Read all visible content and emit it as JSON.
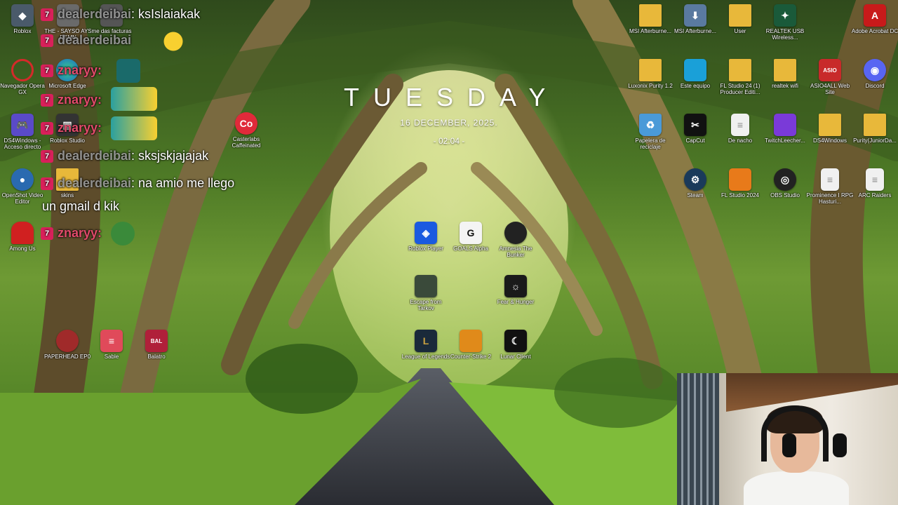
{
  "clock": {
    "day": "TUESDAY",
    "date": "16 DECEMBER, 2025.",
    "time": "- 02:04 -"
  },
  "desktop_icons": [
    {
      "label": "Roblox",
      "icon": "roblox-studio-icon",
      "color": "#4a5a6a"
    },
    {
      "label": "Navegador Opera GX",
      "icon": "opera-gx-icon",
      "color": "#d42a2a"
    },
    {
      "label": "DS4Windows - Acceso directo",
      "icon": "gamepad-icon",
      "color": "#5a4ac8"
    },
    {
      "label": "OpenShot Video Editor",
      "icon": "openshot-icon",
      "color": "#2a6ab0"
    },
    {
      "label": "Among Us",
      "icon": "among-us-icon",
      "color": "#d02020"
    },
    {
      "label": "THE - SAYSO AYS DEMN",
      "icon": "file-icon",
      "color": "#6a6a6a"
    },
    {
      "label": "me das facturas",
      "icon": "file-icon",
      "color": "#555"
    },
    {
      "label": "Microsoft Edge",
      "icon": "edge-icon",
      "color": "#1a8ac8"
    },
    {
      "label": "Roblox Studio",
      "icon": "roblox-icon",
      "color": "#333"
    },
    {
      "label": "skins",
      "icon": "folder-icon",
      "color": "#e8b83a"
    },
    {
      "label": "Casterlabs Caffeinated",
      "icon": "casterlabs-icon",
      "color": "#e02a3a"
    },
    {
      "label": "PAPERHEAD EP0",
      "icon": "paperhead-icon",
      "color": "#a02a2a"
    },
    {
      "label": "Sable",
      "icon": "sable-icon",
      "color": "#e04a5a"
    },
    {
      "label": "Balatro",
      "icon": "balatro-icon",
      "color": "#b0203a"
    },
    {
      "label": "Roblox Player",
      "icon": "roblox-player-icon",
      "color": "#1a5ae0"
    },
    {
      "label": "GOALS Alpha",
      "icon": "goals-icon",
      "color": "#f4f4f4"
    },
    {
      "label": "Amnesia The Bunker",
      "icon": "amnesia-icon",
      "color": "#222"
    },
    {
      "label": "Escape from Tarkov",
      "icon": "tarkov-icon",
      "color": "#3a4a3a"
    },
    {
      "label": "Fear & Hunger",
      "icon": "fear-hunger-icon",
      "color": "#1a1a1a"
    },
    {
      "label": "League of Legends",
      "icon": "league-icon",
      "color": "#1a2a3a"
    },
    {
      "label": "Counter-Strike 2",
      "icon": "cs2-icon",
      "color": "#e08a1a"
    },
    {
      "label": "Lunar Client",
      "icon": "lunar-icon",
      "color": "#111"
    },
    {
      "label": "MSI Afterburne...",
      "icon": "folder-icon",
      "color": "#e8b83a"
    },
    {
      "label": "MSI Afterburne...",
      "icon": "installer-icon",
      "color": "#5a7aa0"
    },
    {
      "label": "User",
      "icon": "folder-icon",
      "color": "#e8b83a"
    },
    {
      "label": "REALTEK USB Wireless...",
      "icon": "realtek-icon",
      "color": "#1a5a3a"
    },
    {
      "label": "Adobe Acrobat DC",
      "icon": "acrobat-icon",
      "color": "#c81a1a"
    },
    {
      "label": "Luxonix Purity 1.2",
      "icon": "folder-icon",
      "color": "#e8b83a"
    },
    {
      "label": "Este equipo",
      "icon": "computer-icon",
      "color": "#1aa0d8"
    },
    {
      "label": "FL Studio 24 (1) Producer Editi...",
      "icon": "folder-icon",
      "color": "#e8b83a"
    },
    {
      "label": "realtek wifi",
      "icon": "folder-icon",
      "color": "#e8b83a"
    },
    {
      "label": "ASIO4ALL Web Site",
      "icon": "asio-icon",
      "color": "#c82a2a"
    },
    {
      "label": "Discord",
      "icon": "discord-icon",
      "color": "#5865f2"
    },
    {
      "label": "Papelera de reciclaje",
      "icon": "recycle-bin-icon",
      "color": "#4a9ad8"
    },
    {
      "label": "CapCut",
      "icon": "capcut-icon",
      "color": "#111"
    },
    {
      "label": "De nacho",
      "icon": "document-icon",
      "color": "#f0f0f0"
    },
    {
      "label": "TwitchLeecher...",
      "icon": "twitch-icon",
      "color": "#7a3ad8"
    },
    {
      "label": "DS4Windows",
      "icon": "folder-icon",
      "color": "#e8b83a"
    },
    {
      "label": "Purity(JuniorDa...",
      "icon": "folder-icon",
      "color": "#e8b83a"
    },
    {
      "label": "Steam",
      "icon": "steam-icon",
      "color": "#1a3a5a"
    },
    {
      "label": "FL Studio 2024",
      "icon": "fl-studio-icon",
      "color": "#e87a1a"
    },
    {
      "label": "OBS Studio",
      "icon": "obs-icon",
      "color": "#222"
    },
    {
      "label": "Prominence I RPG Hasturi...",
      "icon": "document-icon",
      "color": "#f0f0f0"
    },
    {
      "label": "ARC Raiders",
      "icon": "document-icon",
      "color": "#f0f0f0"
    }
  ],
  "chat": {
    "messages": [
      {
        "user": "dealerdeibai",
        "text": ": ksIslaiakak"
      },
      {
        "user": "dealerdeibai",
        "text": ""
      },
      {
        "user": "znaryy:",
        "text": ""
      },
      {
        "user": "znaryy:",
        "text": ""
      },
      {
        "user": "znaryy:",
        "text": ""
      },
      {
        "user": "dealerdeibai",
        "text": ": sksjskjajajak"
      },
      {
        "user": "dealerdeibai",
        "text": ": na amio me llego"
      },
      {
        "user": "",
        "text": "un gmail d kik"
      },
      {
        "user": "znaryy:",
        "text": ""
      }
    ]
  },
  "colors": {
    "chat_badge": "#d8205a",
    "clock_text": "#ffffff"
  }
}
